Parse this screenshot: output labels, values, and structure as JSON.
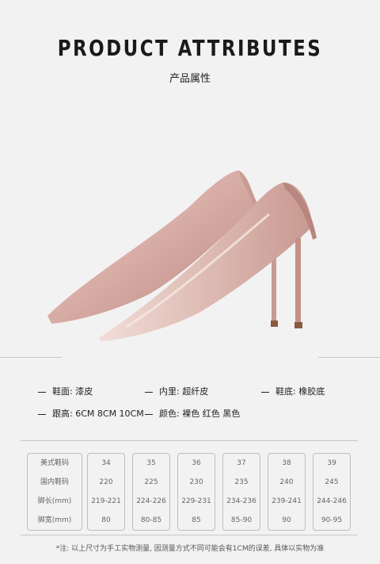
{
  "header": {
    "title": "PRODUCT ATTRIBUTES",
    "subtitle": "产品属性"
  },
  "colors": {
    "background": "#f3f2f2",
    "shoe": "#d9b3ad"
  },
  "attributes": [
    {
      "label": "鞋面:",
      "value": "漆皮"
    },
    {
      "label": "内里:",
      "value": "超纤皮"
    },
    {
      "label": "鞋底:",
      "value": "橡胶底"
    },
    {
      "label": "跟高:",
      "value": "6CM 8CM 10CM"
    },
    {
      "label": "颜色:",
      "value": "裸色 红色 黑色"
    }
  ],
  "size_table": {
    "row_labels": [
      "美式鞋码",
      "国内鞋码",
      "脚长(mm)",
      "脚宽(mm)"
    ],
    "columns": [
      [
        "34",
        "220",
        "219-221",
        "80"
      ],
      [
        "35",
        "225",
        "224-226",
        "80-85"
      ],
      [
        "36",
        "230",
        "229-231",
        "85"
      ],
      [
        "37",
        "235",
        "234-236",
        "85-90"
      ],
      [
        "38",
        "240",
        "239-241",
        "90"
      ],
      [
        "39",
        "245",
        "244-246",
        "90-95"
      ]
    ]
  },
  "note": "*注: 以上尺寸为手工实物测量, 因测量方式不同可能会有1CM的误差, 具体以实物为准"
}
